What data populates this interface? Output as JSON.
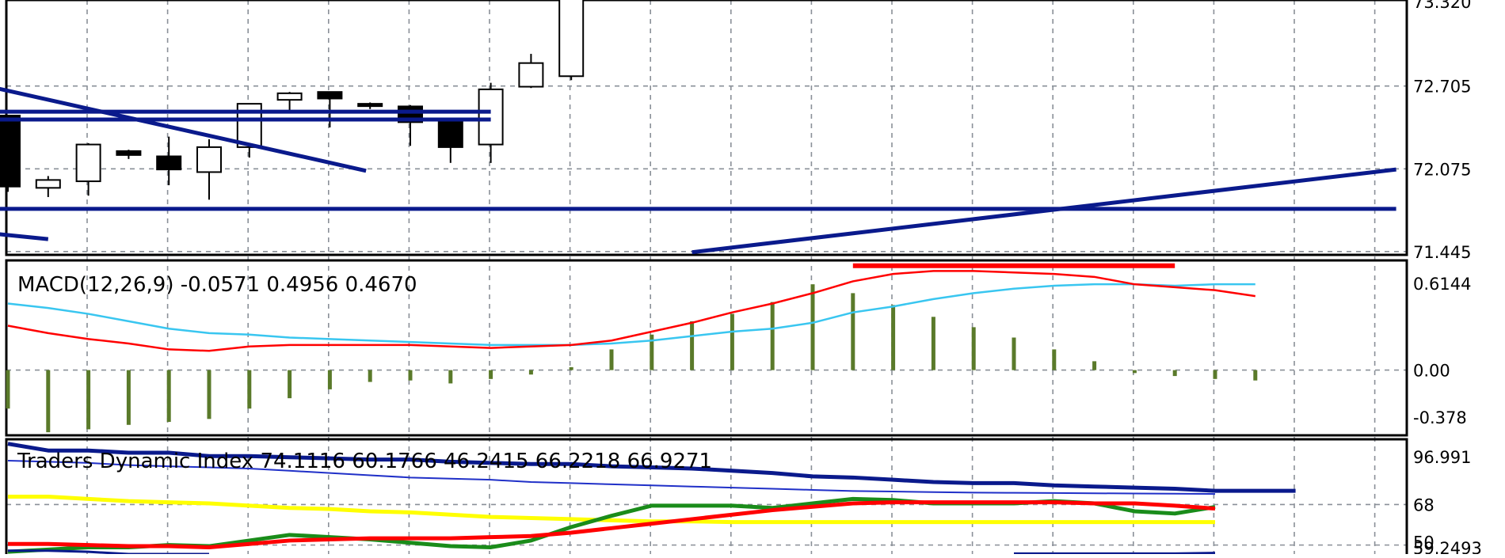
{
  "colors": {
    "background": "#ffffff",
    "grid": "#8a9098",
    "frame": "#000000",
    "trendline": "#0a1a8c",
    "candle_up": "#ffffff",
    "candle_down": "#000000",
    "macd_main": "#ff0000",
    "macd_signal": "#39c6f0",
    "macd_hist": "#5a7a2a",
    "tdi_blue": "#0a1a8c",
    "tdi_thin_blue": "#2030c8",
    "tdi_yellow": "#ffff00",
    "tdi_red": "#ff0000",
    "tdi_green": "#1a8c1a"
  },
  "chart_data": [
    {
      "id": "price",
      "type": "candlestick",
      "y_axis_labels": [
        "73.320",
        "72.705",
        "72.075",
        "71.445"
      ],
      "ylim": [
        71.42,
        73.36
      ],
      "grid": true,
      "candles": [
        {
          "o": 72.48,
          "h": 72.48,
          "l": 71.9,
          "c": 71.94
        },
        {
          "o": 71.93,
          "h": 72.02,
          "l": 71.86,
          "c": 71.99
        },
        {
          "o": 71.98,
          "h": 72.27,
          "l": 71.87,
          "c": 72.26
        },
        {
          "o": 72.21,
          "h": 72.22,
          "l": 72.15,
          "c": 72.18
        },
        {
          "o": 72.17,
          "h": 72.32,
          "l": 71.95,
          "c": 72.07
        },
        {
          "o": 72.05,
          "h": 72.3,
          "l": 71.84,
          "c": 72.24
        },
        {
          "o": 72.24,
          "h": 72.57,
          "l": 72.16,
          "c": 72.57
        },
        {
          "o": 72.6,
          "h": 72.66,
          "l": 72.5,
          "c": 72.65
        },
        {
          "o": 72.66,
          "h": 72.66,
          "l": 72.39,
          "c": 72.61
        },
        {
          "o": 72.57,
          "h": 72.58,
          "l": 72.53,
          "c": 72.56
        },
        {
          "o": 72.55,
          "h": 72.56,
          "l": 72.25,
          "c": 72.43
        },
        {
          "o": 72.43,
          "h": 72.43,
          "l": 72.12,
          "c": 72.24
        },
        {
          "o": 72.26,
          "h": 72.73,
          "l": 72.12,
          "c": 72.68
        },
        {
          "o": 72.7,
          "h": 72.95,
          "l": 72.69,
          "c": 72.88
        },
        {
          "o": 72.78,
          "h": 73.5,
          "l": 72.75,
          "c": 73.4
        }
      ],
      "trendlines": [
        {
          "x": [
            -0.3,
            8.9
          ],
          "y": [
            72.69,
            72.06
          ]
        },
        {
          "x": [
            -0.3,
            12.0
          ],
          "y": [
            72.51,
            72.51
          ]
        },
        {
          "x": [
            -0.3,
            12.0
          ],
          "y": [
            72.45,
            72.45
          ]
        },
        {
          "x": [
            -0.3,
            34.5
          ],
          "y": [
            71.77,
            71.77
          ]
        },
        {
          "x": [
            17.0,
            34.5
          ],
          "y": [
            71.44,
            72.07
          ]
        },
        {
          "x": [
            -0.3,
            1.0
          ],
          "y": [
            71.58,
            71.54
          ]
        }
      ]
    },
    {
      "id": "macd",
      "type": "line+bar",
      "title": "MACD(12,26,9) -0.0571 0.4956 0.4670",
      "y_axis_labels": [
        "0.6144",
        "0.00",
        "-0.378"
      ],
      "ylim": [
        -0.43,
        0.72
      ],
      "histogram": [
        -0.26,
        -0.42,
        -0.4,
        -0.37,
        -0.35,
        -0.33,
        -0.26,
        -0.19,
        -0.13,
        -0.08,
        -0.07,
        -0.09,
        -0.06,
        -0.03,
        0.02,
        0.14,
        0.24,
        0.33,
        0.38,
        0.46,
        0.58,
        0.52,
        0.44,
        0.36,
        0.29,
        0.22,
        0.14,
        0.06,
        -0.02,
        -0.04,
        -0.06,
        -0.07
      ],
      "main": [
        0.3,
        0.25,
        0.21,
        0.18,
        0.14,
        0.13,
        0.16,
        0.17,
        0.17,
        0.17,
        0.17,
        0.16,
        0.15,
        0.16,
        0.17,
        0.2,
        0.26,
        0.32,
        0.39,
        0.45,
        0.52,
        0.6,
        0.65,
        0.67,
        0.67,
        0.66,
        0.65,
        0.63,
        0.58,
        0.56,
        0.54,
        0.5
      ],
      "signal": [
        0.45,
        0.42,
        0.38,
        0.33,
        0.28,
        0.25,
        0.24,
        0.22,
        0.21,
        0.2,
        0.19,
        0.18,
        0.17,
        0.17,
        0.17,
        0.18,
        0.2,
        0.23,
        0.26,
        0.28,
        0.32,
        0.39,
        0.43,
        0.48,
        0.52,
        0.55,
        0.57,
        0.58,
        0.58,
        0.57,
        0.58,
        0.58
      ],
      "level_line": {
        "from": 21,
        "to": 29,
        "y": 0.705
      }
    },
    {
      "id": "tdi",
      "type": "line",
      "title": "Traders Dynamic Index 74.1116 60.1766 46.2415 66.2218 66.9271",
      "y_axis_labels": [
        "96.991",
        "68",
        "50",
        "59.2493"
      ],
      "ylim": [
        46.0,
        96.991
      ],
      "levels": [
        68,
        50
      ],
      "blue_upper": [
        95.0,
        92.0,
        92.0,
        91.0,
        91.0,
        89.5,
        89.5,
        89.0,
        88.5,
        88.0,
        88.0,
        87.0,
        86.5,
        86.0,
        86.0,
        85.0,
        84.5,
        84.0,
        83.0,
        82.0,
        80.5,
        80.0,
        79.0,
        78.0,
        77.5,
        77.5,
        76.5,
        76.0,
        75.5,
        75.0,
        74.1,
        74.1,
        74.1
      ],
      "blue_thin": [
        87.5,
        87.0,
        86.5,
        85.5,
        85.0,
        84.5,
        84.0,
        83.0,
        82.0,
        81.0,
        80.0,
        79.5,
        79.0,
        78.0,
        77.5,
        77.0,
        76.5,
        76.0,
        75.5,
        75.0,
        74.5,
        74.0,
        73.8,
        73.5,
        73.3,
        73.2,
        73.1,
        73.0,
        72.9,
        72.8,
        72.7
      ],
      "yellow": [
        71.5,
        71.5,
        70.5,
        69.5,
        69.0,
        68.5,
        67.5,
        66.5,
        66.0,
        65.0,
        64.5,
        63.5,
        62.5,
        62.0,
        61.5,
        61.0,
        60.5,
        60.5,
        60.2,
        60.2,
        60.2,
        60.2,
        60.2,
        60.2,
        60.2,
        60.2,
        60.2,
        60.2,
        60.2,
        60.2,
        60.2
      ],
      "red": [
        50.5,
        50.5,
        50.0,
        49.5,
        49.5,
        49.0,
        50.5,
        52.0,
        52.5,
        53.0,
        53.0,
        53.0,
        53.5,
        54.0,
        55.5,
        57.5,
        59.5,
        61.5,
        63.5,
        65.5,
        67.0,
        68.5,
        69.0,
        69.0,
        69.0,
        69.0,
        69.0,
        68.5,
        68.5,
        67.5,
        66.2
      ],
      "green": [
        47.0,
        48.0,
        49.0,
        49.0,
        50.0,
        49.5,
        52.0,
        54.5,
        53.5,
        52.5,
        51.0,
        49.5,
        49.0,
        52.0,
        58.0,
        63.0,
        67.5,
        67.5,
        67.5,
        66.5,
        68.5,
        70.5,
        70.0,
        68.5,
        68.5,
        68.5,
        69.5,
        68.5,
        65.0,
        64.0,
        66.9
      ],
      "blue_lower": [
        47.5,
        47.5,
        47.0,
        46.0,
        46.0,
        46.0
      ],
      "blue_lower_right": [
        46.2,
        46.2,
        46.2,
        46.2,
        46.2,
        46.5
      ]
    }
  ]
}
